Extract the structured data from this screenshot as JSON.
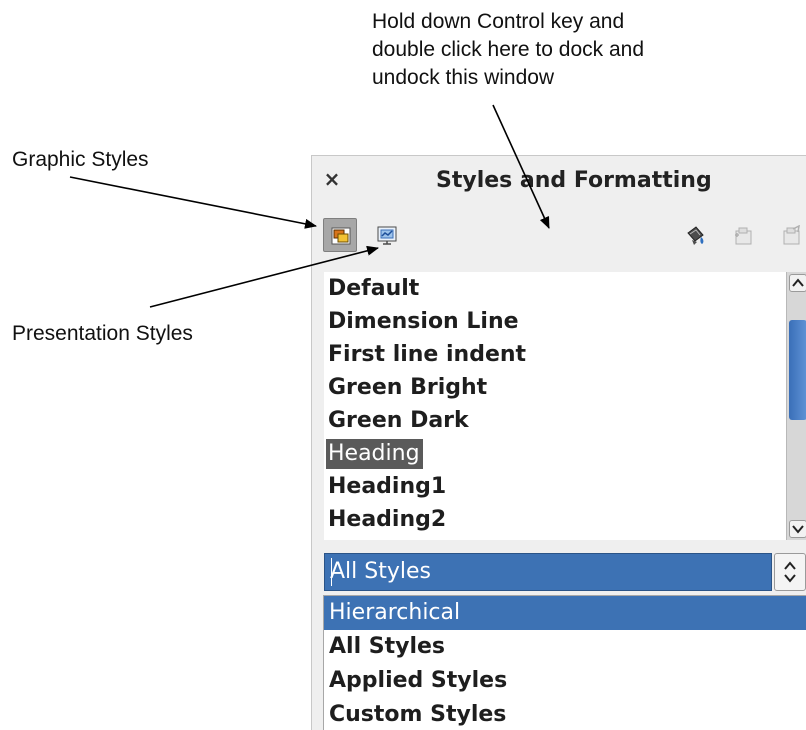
{
  "annotations": {
    "dock_line1": "Hold down Control key and",
    "dock_line2": "double click here to dock and",
    "dock_line3": "undock this window",
    "graphic_styles": "Graphic Styles",
    "presentation_styles": "Presentation Styles"
  },
  "panel": {
    "title": "Styles and Formatting",
    "close_icon": "close-icon"
  },
  "toolbar": {
    "graphic_styles_icon": "graphic-styles-icon",
    "presentation_styles_icon": "presentation-styles-icon",
    "fill_format_icon": "fill-format-mode-icon",
    "new_style_icon": "new-style-from-selection-icon",
    "update_style_icon": "update-style-icon"
  },
  "style_list": {
    "items": [
      "Default",
      "Dimension Line",
      "First line indent",
      "Green Bright",
      "Green Dark",
      "Heading",
      "Heading1",
      "Heading2"
    ],
    "selected": "Heading"
  },
  "filter": {
    "selected": "All Styles",
    "options": [
      "Hierarchical",
      "All Styles",
      "Applied Styles",
      "Custom Styles"
    ],
    "highlighted": "Hierarchical"
  },
  "colors": {
    "selection": "#3d72b4",
    "list_selection": "#5a5a5a",
    "panel_bg": "#efefef"
  }
}
